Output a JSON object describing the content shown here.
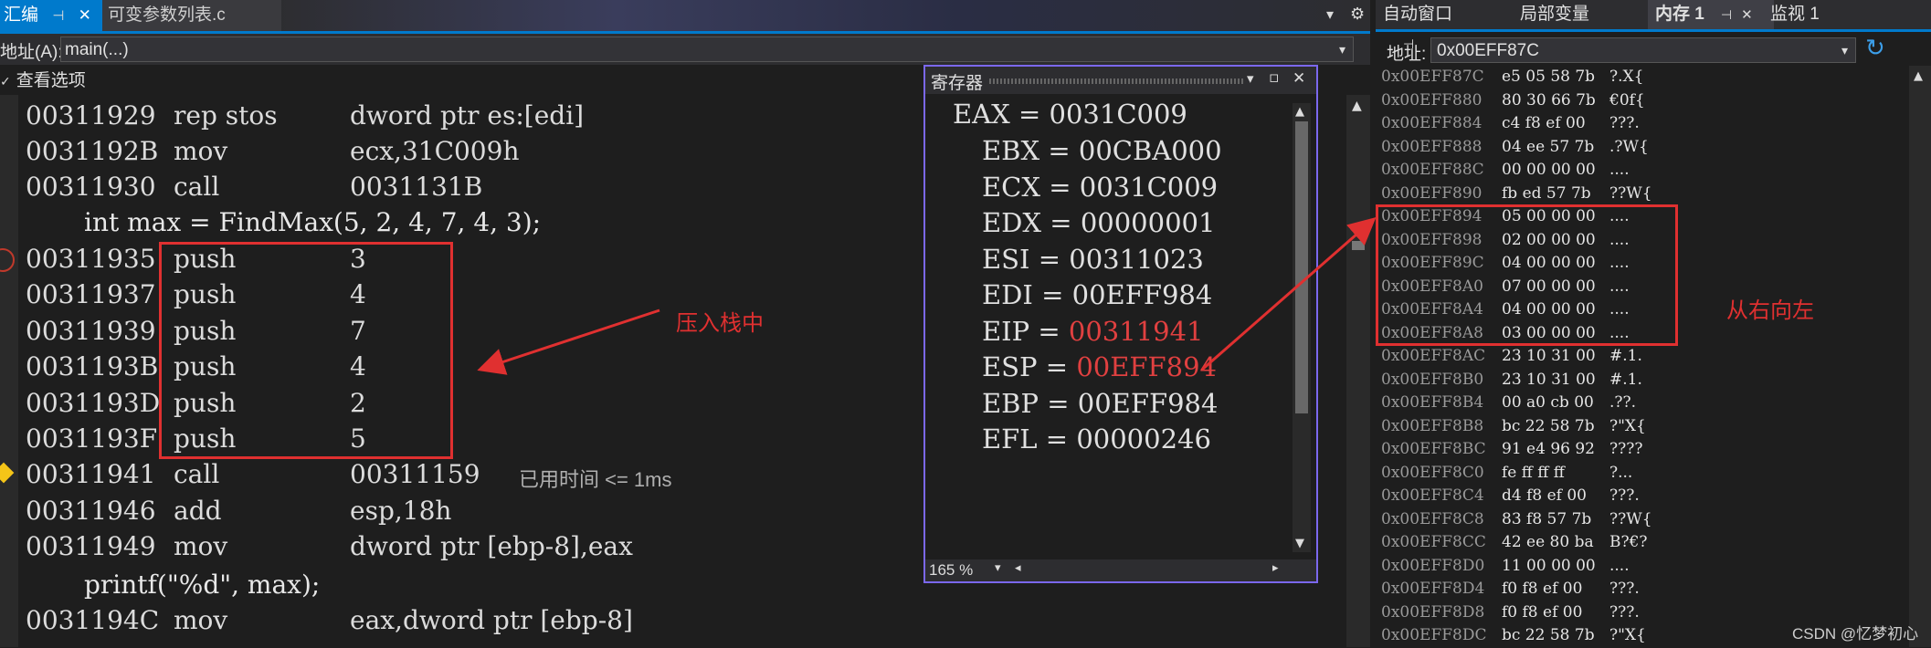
{
  "left_panel": {
    "tabs": [
      {
        "label": "汇编",
        "pin": "⊣",
        "close": "✕"
      },
      {
        "label": "可变参数列表.c"
      }
    ],
    "address_label": "地址(A):",
    "address_value": "main(...)",
    "view_options": "查看选项",
    "code_lines": [
      {
        "type": "asm",
        "addr": "00311929",
        "op": "rep stos",
        "arg": "dword ptr es:[edi]"
      },
      {
        "type": "asm",
        "addr": "0031192B",
        "op": "mov",
        "arg": "ecx,31C009h"
      },
      {
        "type": "asm",
        "addr": "00311930",
        "op": "call",
        "arg": "0031131B"
      },
      {
        "type": "src",
        "text": "int max = FindMax(5, 2, 4, 7, 4, 3);"
      },
      {
        "type": "asm",
        "addr": "00311935",
        "op": "push",
        "arg": "3"
      },
      {
        "type": "asm",
        "addr": "00311937",
        "op": "push",
        "arg": "4"
      },
      {
        "type": "asm",
        "addr": "00311939",
        "op": "push",
        "arg": "7"
      },
      {
        "type": "asm",
        "addr": "0031193B",
        "op": "push",
        "arg": "4"
      },
      {
        "type": "asm",
        "addr": "0031193D",
        "op": "push",
        "arg": "2"
      },
      {
        "type": "asm",
        "addr": "0031193F",
        "op": "push",
        "arg": "5"
      },
      {
        "type": "asm",
        "addr": "00311941",
        "op": "call",
        "arg": "00311159"
      },
      {
        "type": "asm",
        "addr": "00311946",
        "op": "add",
        "arg": "esp,18h"
      },
      {
        "type": "asm",
        "addr": "00311949",
        "op": "mov",
        "arg": "dword ptr [ebp-8],eax"
      },
      {
        "type": "src",
        "text": "printf(\"%d\", max);"
      },
      {
        "type": "asm",
        "addr": "0031194C",
        "op": "mov",
        "arg": "eax,dword ptr [ebp-8]"
      }
    ],
    "elapsed": "已用时间 <= 1ms",
    "annotation_push": "压入栈中"
  },
  "registers_window": {
    "title": "寄存器",
    "registers": [
      {
        "name": "EAX",
        "value": "0031C009",
        "changed": false
      },
      {
        "name": "EBX",
        "value": "00CBA000",
        "changed": false
      },
      {
        "name": "ECX",
        "value": "0031C009",
        "changed": false
      },
      {
        "name": "EDX",
        "value": "00000001",
        "changed": false
      },
      {
        "name": "ESI",
        "value": "00311023",
        "changed": false
      },
      {
        "name": "EDI",
        "value": "00EFF984",
        "changed": false
      },
      {
        "name": "EIP",
        "value": "00311941",
        "changed": true
      },
      {
        "name": "ESP",
        "value": "00EFF894",
        "changed": true
      },
      {
        "name": "EBP",
        "value": "00EFF984",
        "changed": false
      },
      {
        "name": "EFL",
        "value": "00000246",
        "changed": false
      }
    ],
    "zoom": "165 %"
  },
  "right_panel": {
    "tabs": [
      {
        "label": "自动窗口",
        "active": false
      },
      {
        "label": "局部变量",
        "active": false
      },
      {
        "label": "内存 1",
        "active": true
      },
      {
        "label": "监视 1",
        "active": false
      }
    ],
    "address_label": "地址:",
    "address_value": "0x00EFF87C",
    "memory_rows": [
      {
        "addr": "0x00EFF87C",
        "bytes": "e5 05 58 7b",
        "ascii": "?.X{"
      },
      {
        "addr": "0x00EFF880",
        "bytes": "80 30 66 7b",
        "ascii": "€0f{"
      },
      {
        "addr": "0x00EFF884",
        "bytes": "c4 f8 ef 00",
        "ascii": "???."
      },
      {
        "addr": "0x00EFF888",
        "bytes": "04 ee 57 7b",
        "ascii": ".?W{"
      },
      {
        "addr": "0x00EFF88C",
        "bytes": "00 00 00 00",
        "ascii": "...."
      },
      {
        "addr": "0x00EFF890",
        "bytes": "fb ed 57 7b",
        "ascii": "??W{"
      },
      {
        "addr": "0x00EFF894",
        "bytes": "05 00 00 00",
        "ascii": "...."
      },
      {
        "addr": "0x00EFF898",
        "bytes": "02 00 00 00",
        "ascii": "...."
      },
      {
        "addr": "0x00EFF89C",
        "bytes": "04 00 00 00",
        "ascii": "...."
      },
      {
        "addr": "0x00EFF8A0",
        "bytes": "07 00 00 00",
        "ascii": "...."
      },
      {
        "addr": "0x00EFF8A4",
        "bytes": "04 00 00 00",
        "ascii": "...."
      },
      {
        "addr": "0x00EFF8A8",
        "bytes": "03 00 00 00",
        "ascii": "...."
      },
      {
        "addr": "0x00EFF8AC",
        "bytes": "23 10 31 00",
        "ascii": "#.1."
      },
      {
        "addr": "0x00EFF8B0",
        "bytes": "23 10 31 00",
        "ascii": "#.1."
      },
      {
        "addr": "0x00EFF8B4",
        "bytes": "00 a0 cb 00",
        "ascii": ".??."
      },
      {
        "addr": "0x00EFF8B8",
        "bytes": "bc 22 58 7b",
        "ascii": "?\"X{"
      },
      {
        "addr": "0x00EFF8BC",
        "bytes": "91 e4 96 92",
        "ascii": "????"
      },
      {
        "addr": "0x00EFF8C0",
        "bytes": "fe ff ff ff",
        "ascii": "?..."
      },
      {
        "addr": "0x00EFF8C4",
        "bytes": "d4 f8 ef 00",
        "ascii": "???."
      },
      {
        "addr": "0x00EFF8C8",
        "bytes": "83 f8 57 7b",
        "ascii": "??W{"
      },
      {
        "addr": "0x00EFF8CC",
        "bytes": "42 ee 80 ba",
        "ascii": "B?€?"
      },
      {
        "addr": "0x00EFF8D0",
        "bytes": "11 00 00 00",
        "ascii": "...."
      },
      {
        "addr": "0x00EFF8D4",
        "bytes": "f0 f8 ef 00",
        "ascii": "???."
      },
      {
        "addr": "0x00EFF8D8",
        "bytes": "f0 f8 ef 00",
        "ascii": "???."
      },
      {
        "addr": "0x00EFF8DC",
        "bytes": "bc 22 58 7b",
        "ascii": "?\"X{"
      }
    ],
    "annotation_order": "从右向左"
  },
  "watermark": "CSDN @忆梦初心",
  "colors": {
    "accent": "#007acc",
    "annotation_red": "#e03030",
    "changed_register": "#e04040",
    "register_window_border": "#7b68ee"
  }
}
